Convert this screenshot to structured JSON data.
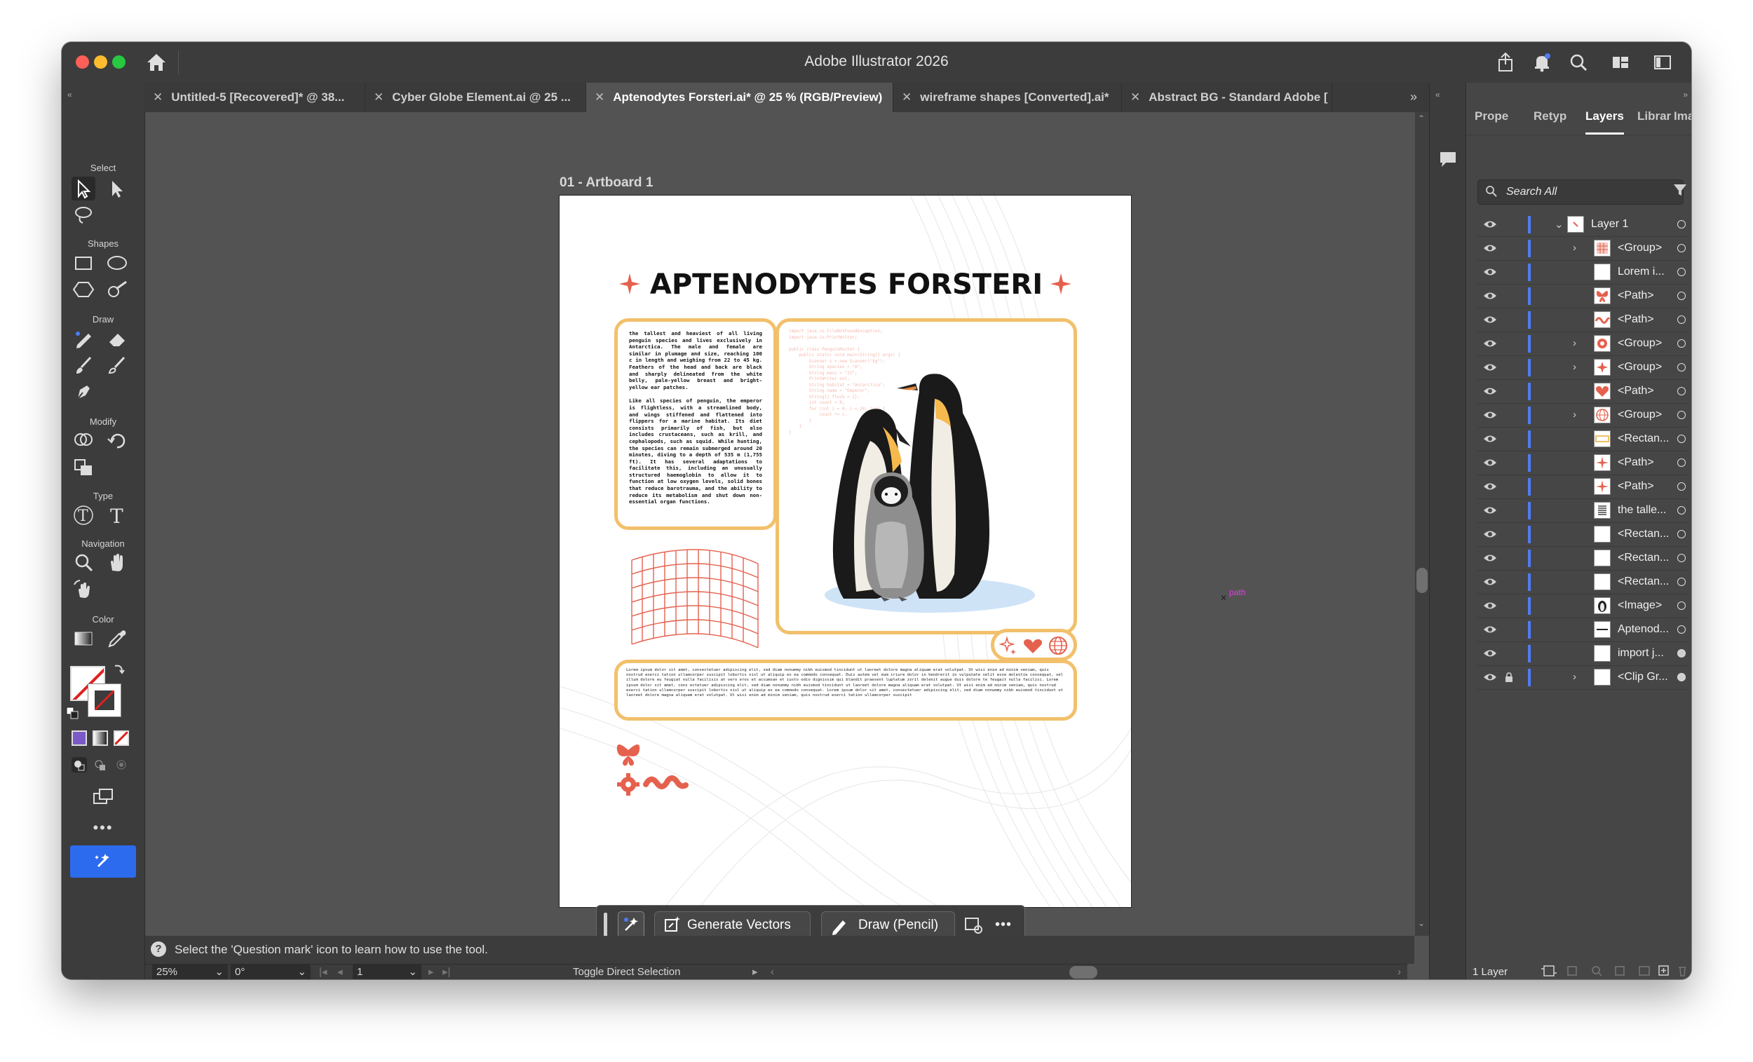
{
  "app": {
    "title": "Adobe Illustrator 2026",
    "colors": {
      "accent": "#4f7cf5",
      "tool_active": "#2c6bed",
      "orange": "#f2c06b",
      "coral": "#e5614e",
      "close": "#ff5f57",
      "minimize": "#febc2e",
      "zoom": "#28c840"
    }
  },
  "tabs": [
    {
      "label": "Untitled-5 [Recovered]* @ 38...",
      "active": false
    },
    {
      "label": "Cyber Globe Element.ai @ 25 ...",
      "active": false
    },
    {
      "label": "Aptenodytes Forsteri.ai* @ 25 % (RGB/Preview)",
      "active": true
    },
    {
      "label": "wireframe shapes [Converted].ai*",
      "active": false
    },
    {
      "label": "Abstract BG - Standard Adobe [",
      "active": false
    }
  ],
  "toolbar": {
    "sections": {
      "select": "Select",
      "shapes": "Shapes",
      "draw": "Draw",
      "modify": "Modify",
      "type": "Type",
      "navigation": "Navigation",
      "color": "Color"
    }
  },
  "artboard": {
    "label": "01 - Artboard 1",
    "title": "APTENODYTES FORSTERI",
    "para1": "the tallest and heaviest of all living penguin species and lives exclusively in Antarctica. The male and female are similar in plumage and size, reaching 100 c in length and weighing from 22 to 45 kg. Feathers of the head and back are black and sharply delineated from the white belly, pale-yellow breast and bright-yellow ear patches.",
    "para2": "Like all species of penguin, the emperor is flightless, with a streamlined body, and wings stiffened and flattened into flippers for a marine habitat. Its diet consists primarily of fish, but also includes crustaceans, such as krill, and cephalopods, such as squid. While hunting, the species can remain submerged around 20 minutes, diving to a depth of 535 m (1,755 ft). It has several adaptations to facilitate this, including an unusually structured haemoglobin to allow it to function at low oxygen levels, solid bones that reduce barotrauma, and the ability to reduce its metabolism and shut down non-essential organ functions.",
    "lorem": "Lorem ipsum dolor sit amet, consectetuer adipiscing elit, sed diam nonummy nibh euismod tincidunt ut laoreet dolore magna aliquam erat volutpat. Ut wisi enim ad minim veniam, quis nostrud exerci tation ullamcorper suscipit lobortis nisl ut aliquip ex ea commodo consequat. Duis autem vel eum iriure dolor in hendrerit in vulputate velit esse molestie consequat, vel illum dolore eu feugiat nulla facilisis at vero eros et accumsan et iusto odio dignissim qui blandit praesent luptatum zzril delenit augue duis dolore te feugait nulla facilisi. Lorem ipsum dolor sit amet, cons ectetuer adipiscing elit, sed diam nonummy nibh euismod tincidunt ut laoreet dolore magna aliquam erat volutpat. Ut wisi enim ad minim veniam, quis nostrud exerci tation ullamcorper suscipit lobortis nisl ut aliquip ex ea commodo consequat. Lorem ipsum dolor sit amet, consectetuer adipiscing elit, sed diam nonummy nibh euismod tincidunt ut laoreet dolore magna aliquam erat volutpat. Ut wisi enim ad minim veniam, quis nostrud exerci tation ullamcorper suscipit",
    "code": "import java.io.FileNotFoundException;\nimport java.io.PrintWriter;\n\npublic class PenguinRoster {\n    public static void main(String[] args) {\n        Scanner s = new Scanner(\"kg\");\n        String species = \"A\";\n        String mass = \"22\";\n        PrintWriter out;\n        String habitat = \"Antarctica\";\n        String name = \"Emperor\";\n        String[] flock = {};\n        int count = 0;\n        for (int i = 0; i < 20; i++) {\n            count += i;\n        }\n    }\n}",
    "path_label": "path"
  },
  "context_bar": {
    "generate_vectors": "Generate Vectors",
    "draw_pencil": "Draw (Pencil)"
  },
  "status": {
    "hint": "Select the 'Question mark' icon to learn how to use the tool.",
    "zoom": "25%",
    "rotation": "0°",
    "artboard_num": "1",
    "tool_status": "Toggle Direct Selection"
  },
  "panel": {
    "tabs": [
      "Prope",
      "Retyp",
      "Layers",
      "Librar",
      "Image"
    ],
    "active_tab": "Layers",
    "search_placeholder": "Search All",
    "layer_count": "1 Layer",
    "layers": [
      {
        "name": "Layer 1",
        "level": 0,
        "expandable": true,
        "expanded": true,
        "locked": false,
        "thumb": "layer"
      },
      {
        "name": "<Group>",
        "level": 1,
        "expandable": true,
        "locked": false,
        "thumb": "grid"
      },
      {
        "name": "Lorem i...",
        "level": 1,
        "expandable": false,
        "locked": false,
        "thumb": "blank"
      },
      {
        "name": "<Path>",
        "level": 1,
        "expandable": false,
        "locked": false,
        "thumb": "butterfly"
      },
      {
        "name": "<Path>",
        "level": 1,
        "expandable": false,
        "locked": false,
        "thumb": "wave"
      },
      {
        "name": "<Group>",
        "level": 1,
        "expandable": true,
        "locked": false,
        "thumb": "gear"
      },
      {
        "name": "<Group>",
        "level": 1,
        "expandable": true,
        "locked": false,
        "thumb": "sparkle"
      },
      {
        "name": "<Path>",
        "level": 1,
        "expandable": false,
        "locked": false,
        "thumb": "heart"
      },
      {
        "name": "<Group>",
        "level": 1,
        "expandable": true,
        "locked": false,
        "thumb": "globe"
      },
      {
        "name": "<Rectan...",
        "level": 1,
        "expandable": false,
        "locked": false,
        "thumb": "rect-orange"
      },
      {
        "name": "<Path>",
        "level": 1,
        "expandable": false,
        "locked": false,
        "thumb": "star"
      },
      {
        "name": "<Path>",
        "level": 1,
        "expandable": false,
        "locked": false,
        "thumb": "star"
      },
      {
        "name": "the talle...",
        "level": 1,
        "expandable": false,
        "locked": false,
        "thumb": "text"
      },
      {
        "name": "<Rectan...",
        "level": 1,
        "expandable": false,
        "locked": false,
        "thumb": "blank"
      },
      {
        "name": "<Rectan...",
        "level": 1,
        "expandable": false,
        "locked": false,
        "thumb": "blank"
      },
      {
        "name": "<Rectan...",
        "level": 1,
        "expandable": false,
        "locked": false,
        "thumb": "blank"
      },
      {
        "name": "<Image>",
        "level": 1,
        "expandable": false,
        "locked": false,
        "thumb": "penguin"
      },
      {
        "name": "Aptenod...",
        "level": 1,
        "expandable": false,
        "locked": false,
        "thumb": "title"
      },
      {
        "name": "import j...",
        "level": 1,
        "expandable": false,
        "locked": false,
        "thumb": "blank",
        "target_filled": true
      },
      {
        "name": "<Clip Gr...",
        "level": 1,
        "expandable": true,
        "locked": true,
        "thumb": "blank",
        "target_filled": true
      }
    ]
  }
}
